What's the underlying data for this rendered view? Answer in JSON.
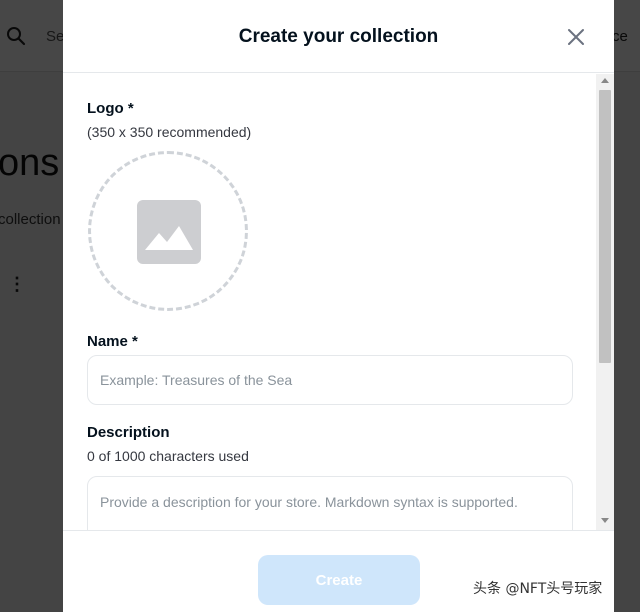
{
  "background": {
    "search_text": "Se",
    "right_text": "ce",
    "heading": "ons",
    "subtext": "collection",
    "kebab": "⋮"
  },
  "modal": {
    "title": "Create your collection",
    "close_icon": "close-icon",
    "logo": {
      "label": "Logo *",
      "hint": "(350 x 350 recommended)",
      "icon": "image-icon"
    },
    "name": {
      "label": "Name *",
      "placeholder": "Example: Treasures of the Sea",
      "value": ""
    },
    "description": {
      "label": "Description",
      "counter": "0 of 1000 characters used",
      "placeholder": "Provide a description for your store. Markdown syntax is supported.",
      "value": ""
    },
    "create_label": "Create"
  },
  "watermark": "头条 @NFT头号玩家",
  "colors": {
    "accent_disabled": "#cfe6fb",
    "title": "#04111d",
    "border": "#e5e8eb"
  }
}
